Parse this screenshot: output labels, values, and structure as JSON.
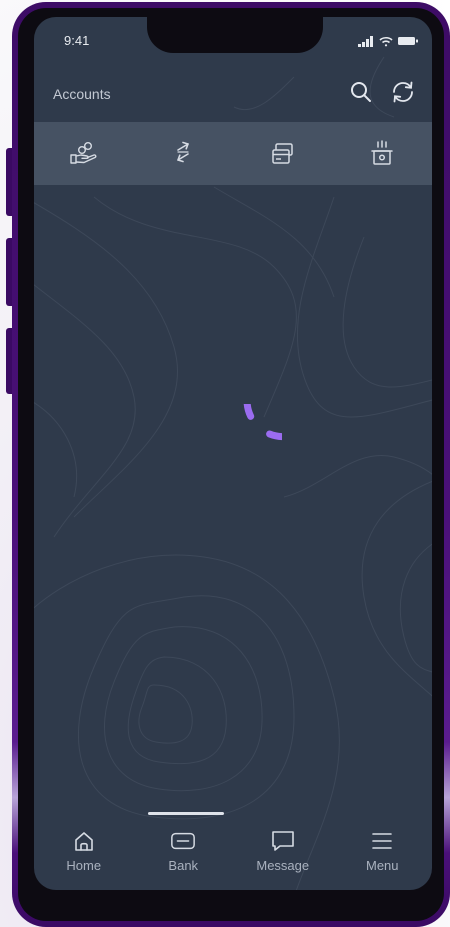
{
  "status_bar": {
    "time": "9:41"
  },
  "header": {
    "title": "Accounts",
    "actions": [
      "search-icon",
      "refresh-icon"
    ]
  },
  "quick_actions": [
    {
      "icon": "hand-coins-icon"
    },
    {
      "icon": "transfer-arrows-icon"
    },
    {
      "icon": "cards-icon"
    },
    {
      "icon": "atm-cash-icon"
    }
  ],
  "loading": {
    "spinner_color": "#9b6cf0"
  },
  "tab_bar": {
    "tabs": [
      {
        "label": "Home",
        "icon": "home-icon"
      },
      {
        "label": "Bank",
        "icon": "bank-card-icon"
      },
      {
        "label": "Message",
        "icon": "message-icon"
      },
      {
        "label": "Menu",
        "icon": "menu-icon"
      }
    ]
  },
  "colors": {
    "screen_bg": "#2f3a4b",
    "quickbar_bg": "#465263",
    "device_frame": "#3d0c66",
    "accent": "#9b6cf0"
  }
}
